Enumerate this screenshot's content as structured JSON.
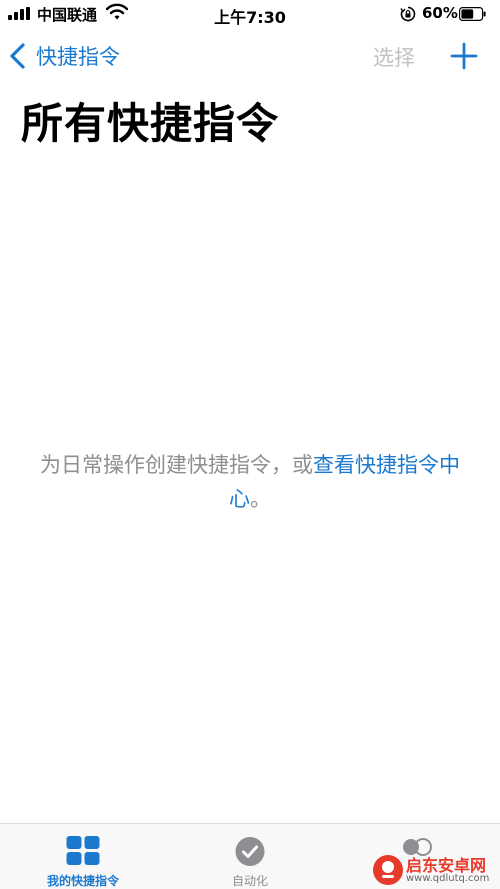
{
  "status_bar": {
    "carrier": "中国联通",
    "time": "上午7:30",
    "battery_percent": "60%",
    "battery_level": 0.6
  },
  "nav": {
    "back_label": "快捷指令",
    "select_label": "选择",
    "add_icon": "plus-icon"
  },
  "page_title": "所有快捷指令",
  "empty_state": {
    "text_prefix": "为日常操作创建快捷指令，或",
    "link_text": "查看快捷指令中心",
    "text_suffix": "。"
  },
  "tab_bar": {
    "tabs": [
      {
        "label": "我的快捷指令",
        "icon": "grid-icon",
        "active": true
      },
      {
        "label": "自动化",
        "icon": "check-clock-icon",
        "active": false
      },
      {
        "label": "",
        "icon": "gallery-icon",
        "active": false
      }
    ]
  },
  "colors": {
    "accent": "#1b7ad0",
    "disabled": "#c2c2c6",
    "secondary_text": "#8e8e93"
  },
  "watermark": {
    "title": "启东安卓网",
    "url": "www.qdlutq.com"
  }
}
